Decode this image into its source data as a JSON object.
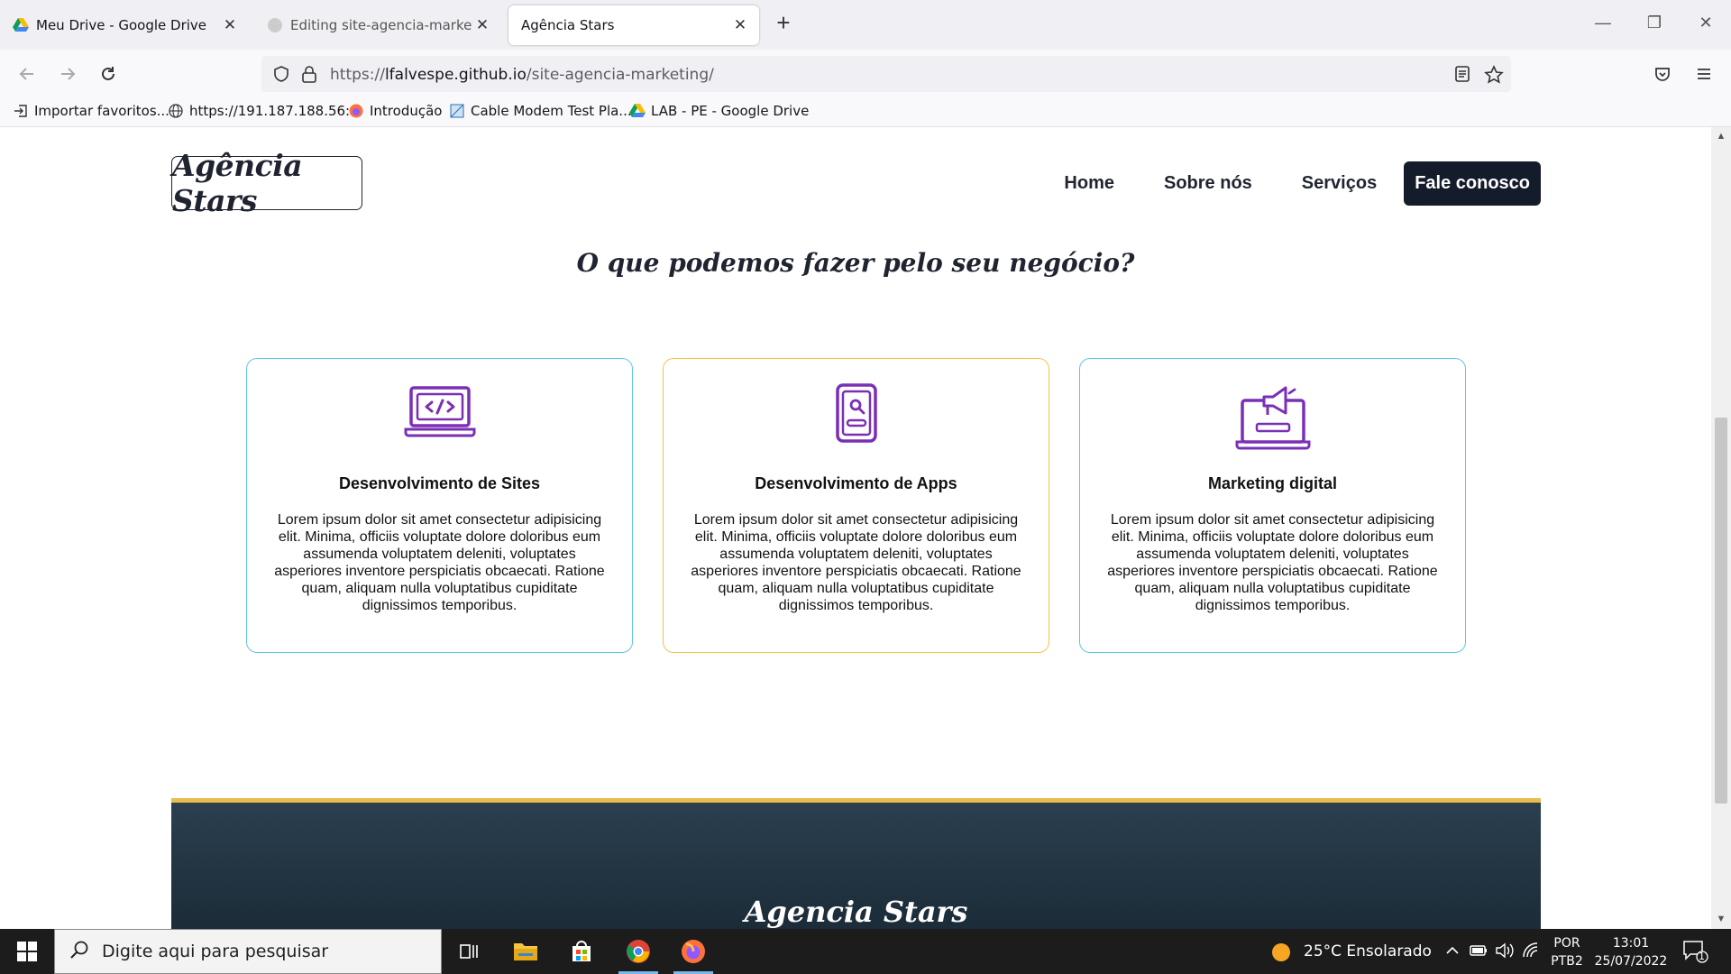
{
  "browser": {
    "tabs": [
      {
        "title": "Meu Drive - Google Drive",
        "icon": "google-drive-icon"
      },
      {
        "title": "Editing site-agencia-marketing/",
        "icon": "github-icon"
      },
      {
        "title": "Agência Stars",
        "icon": "none"
      }
    ],
    "url": {
      "prefix": "https://",
      "host": "lfalvespe.github.io",
      "path": "/site-agencia-marketing/"
    },
    "bookmarks": [
      {
        "label": "Importar favoritos...",
        "icon": "import-icon"
      },
      {
        "label": "https://191.187.188.56:...",
        "icon": "globe-icon"
      },
      {
        "label": "Introdução",
        "icon": "firefox-icon"
      },
      {
        "label": "Cable Modem Test Pla...",
        "icon": "page-icon"
      },
      {
        "label": "LAB - PE - Google Drive",
        "icon": "google-drive-icon"
      }
    ]
  },
  "site": {
    "logo": "Agência Stars",
    "nav": {
      "home": "Home",
      "about": "Sobre nós",
      "services": "Serviços",
      "contact": "Fale conosco"
    },
    "section_title": "O que podemos fazer pelo seu negócio?",
    "cards": [
      {
        "title": "Desenvolvimento de Sites",
        "text": "Lorem ipsum dolor sit amet consectetur adipisicing elit. Minima, officiis voluptate dolore doloribus eum assumenda voluptatem deleniti, voluptates asperiores inventore perspiciatis obcaecati. Ratione quam, aliquam nulla voluptatibus cupiditate dignissimos temporibus.",
        "icon": "laptop-code-icon",
        "border_color": "#5ec8de"
      },
      {
        "title": "Desenvolvimento de Apps",
        "text": "Lorem ipsum dolor sit amet consectetur adipisicing elit. Minima, officiis voluptate dolore doloribus eum assumenda voluptatem deleniti, voluptates asperiores inventore perspiciatis obcaecati. Ratione quam, aliquam nulla voluptatibus cupiditate dignissimos temporibus.",
        "icon": "smartphone-search-icon",
        "border_color": "#f3c34a"
      },
      {
        "title": "Marketing digital",
        "text": "Lorem ipsum dolor sit amet consectetur adipisicing elit. Minima, officiis voluptate dolore doloribus eum assumenda voluptatem deleniti, voluptates asperiores inventore perspiciatis obcaecati. Ratione quam, aliquam nulla voluptatibus cupiditate dignissimos temporibus.",
        "icon": "megaphone-laptop-icon",
        "border_color": "#5ec8de"
      }
    ],
    "footer_title": "Agencia Stars",
    "colors": {
      "accent_purple": "#7b2fb5",
      "dark_navy": "#141c2c",
      "footer_top": "#e9bc4c"
    }
  },
  "taskbar": {
    "search_placeholder": "Digite aqui para pesquisar",
    "weather": "25°C  Ensolarado",
    "lang_1": "POR",
    "lang_2": "PTB2",
    "time": "13:01",
    "date": "25/07/2022",
    "notifications": "1"
  }
}
